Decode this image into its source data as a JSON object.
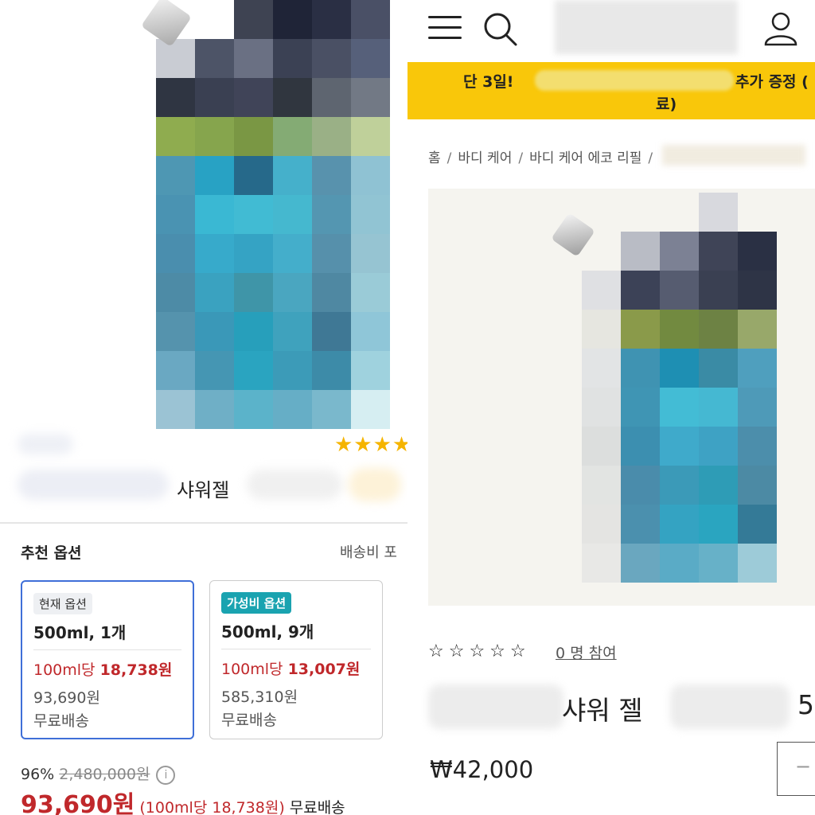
{
  "left": {
    "product_name": "샤워젤",
    "stars": "★★★★",
    "recommended_title": "추천 옵션",
    "shipping_note": "배송비 포",
    "options": [
      {
        "tag": "현재 옵션",
        "size": "500ml, 1개",
        "unit_prefix": "100ml당 ",
        "unit_price": "18,738원",
        "total": "93,690원",
        "shipping": "무료배송"
      },
      {
        "tag": "가성비 옵션",
        "size": "500ml, 9개",
        "unit_prefix": "100ml당 ",
        "unit_price": "13,007원",
        "total": "585,310원",
        "shipping": "무료배송"
      }
    ],
    "discount_rate": "96%",
    "original_price": "2,480,000원",
    "info_icon": "i",
    "sale_price": "93,690원",
    "unit_note": "(100ml당 18,738원)",
    "shipping": "무료배송"
  },
  "right": {
    "icons": [
      "menu-icon",
      "search-icon",
      "user-icon"
    ],
    "banner": {
      "line1_left": "단 3일!",
      "line1_right": "추가 증정 (",
      "line2": "료)"
    },
    "breadcrumbs": [
      "홈",
      "바디 케어",
      "바디 케어 에코 리필"
    ],
    "rating_stars": "☆☆☆☆☆",
    "review_count": "0 명 참여",
    "product_name": "샤워 젤",
    "product_name_tail": "5",
    "price": "₩42,000",
    "stepper_minus": "−"
  },
  "colors": {
    "accent_red": "#c0282b",
    "selected_border": "#3f6fd8",
    "value_tag": "#1aa3b0",
    "banner_yellow": "#f9c70a",
    "star_gold": "#f5b400"
  }
}
